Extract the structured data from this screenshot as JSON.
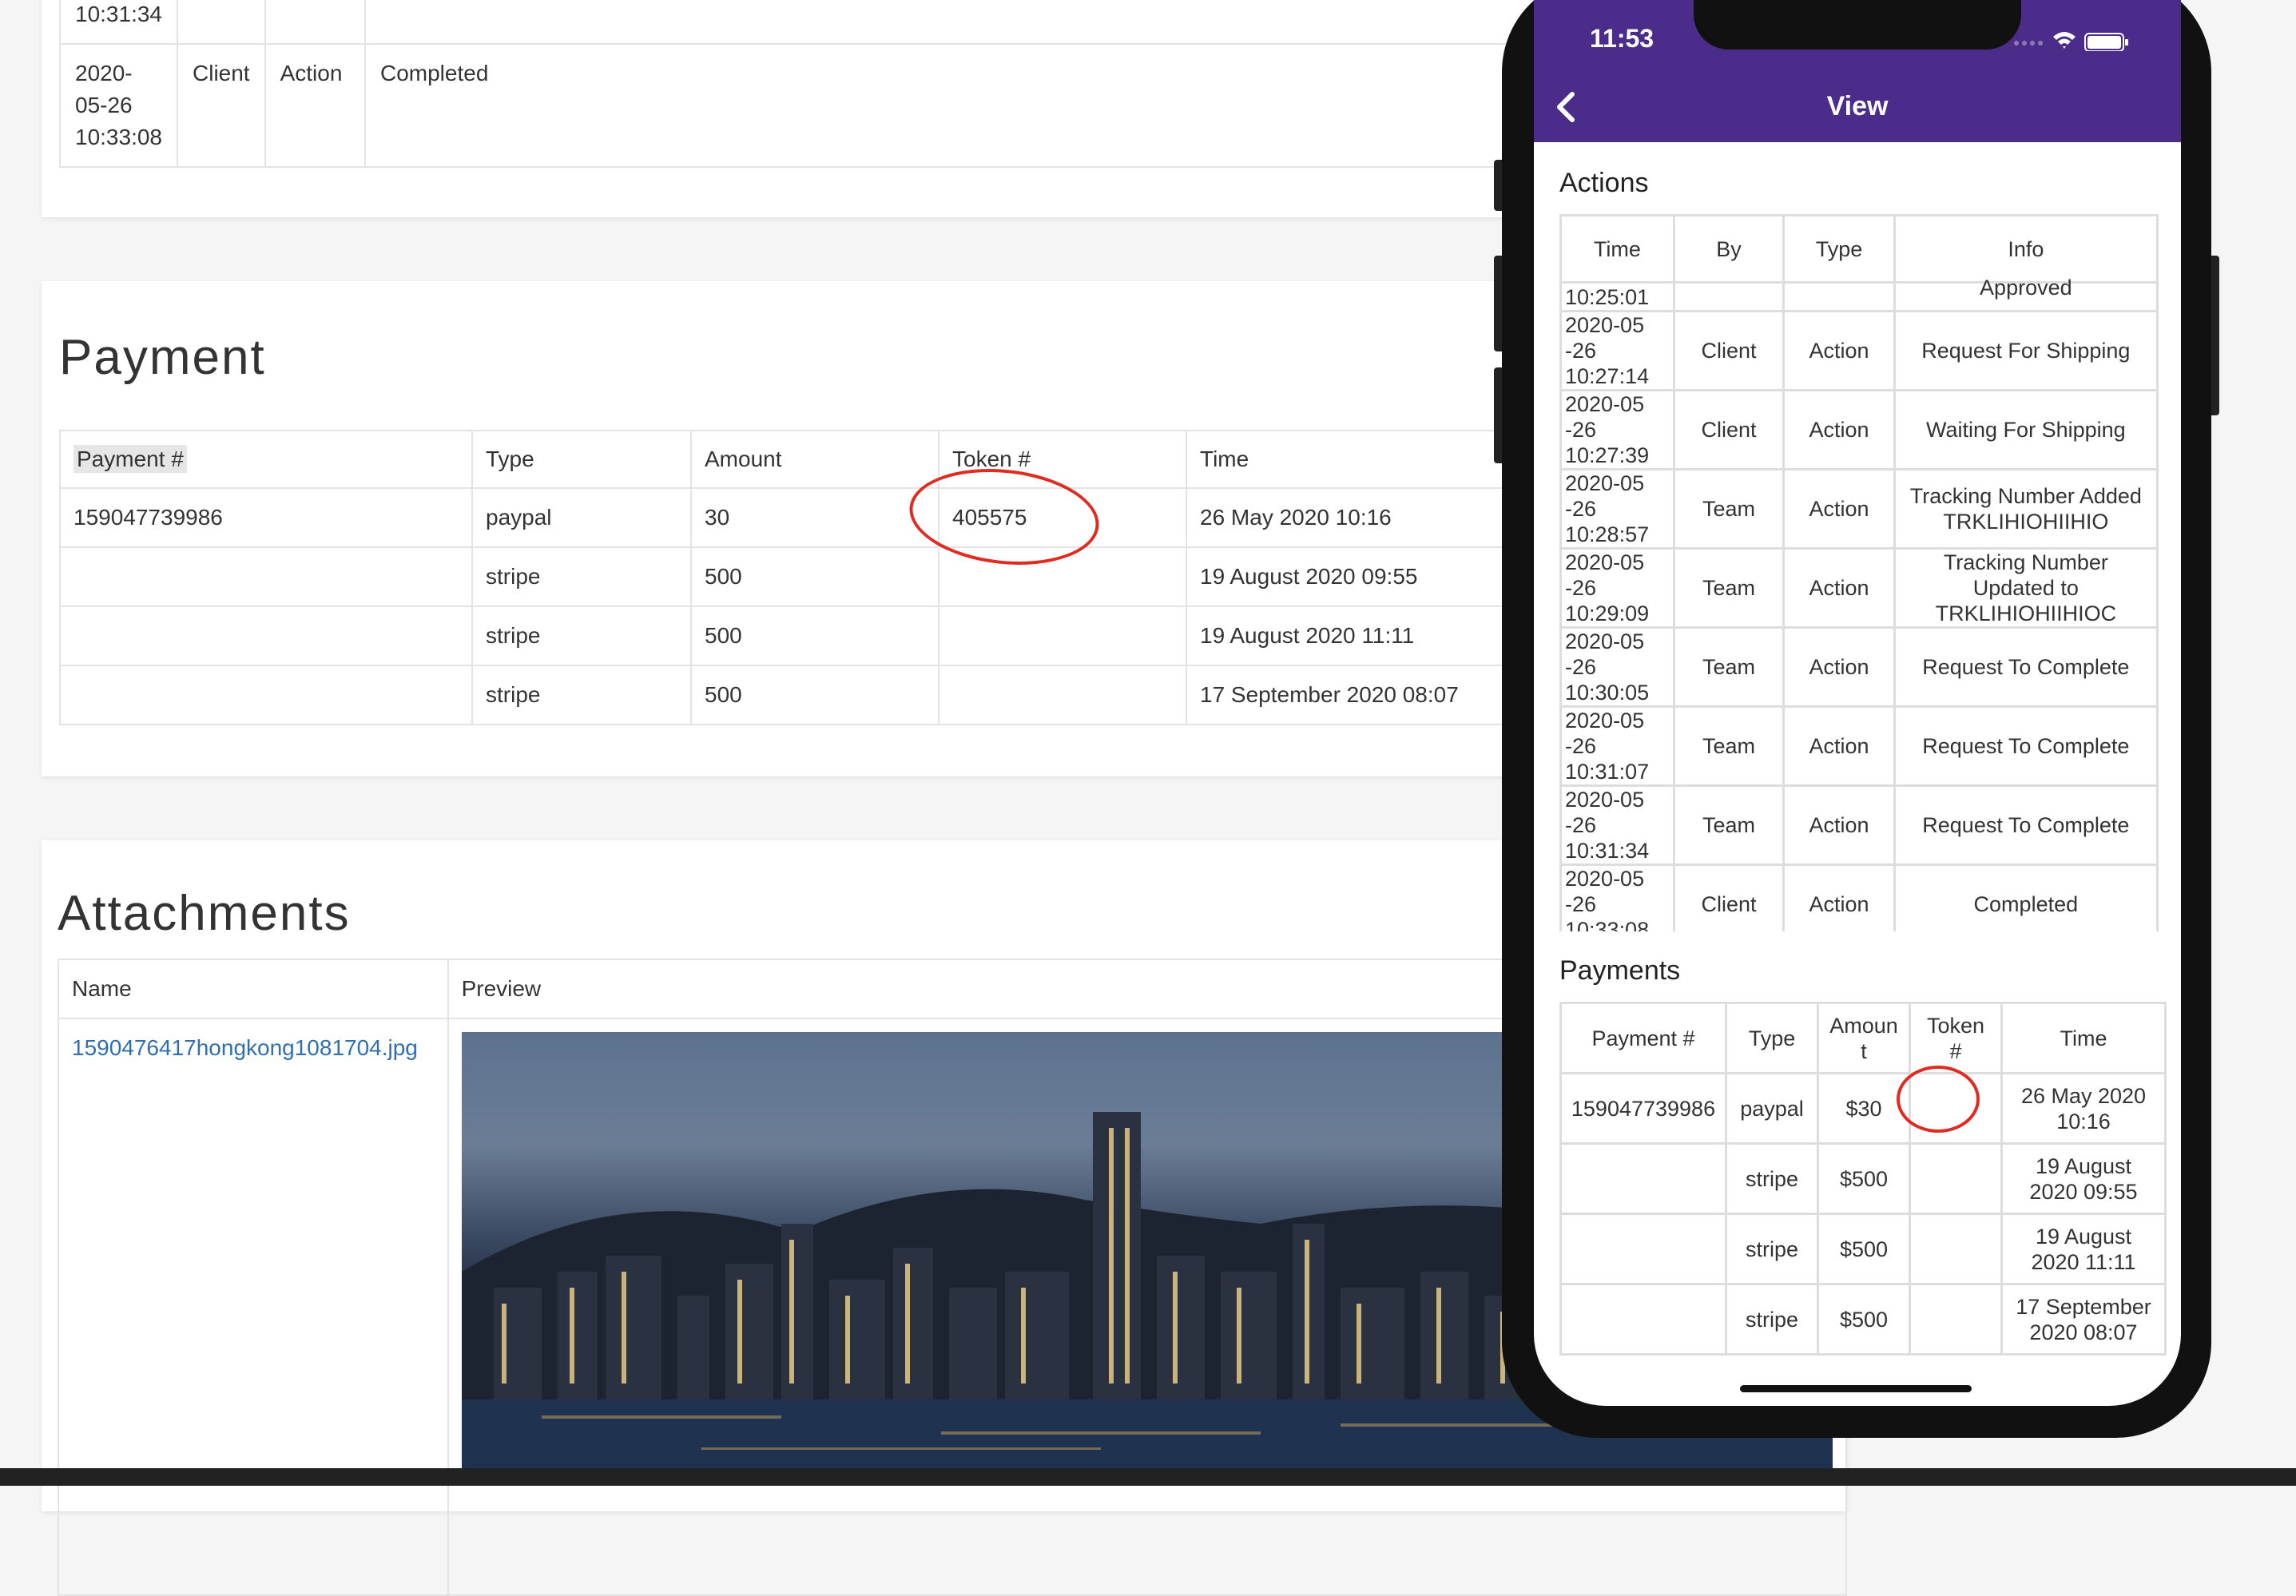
{
  "top_table": {
    "rows": [
      {
        "time": "10:31:34",
        "by": "",
        "type": "",
        "info": ""
      },
      {
        "time": "2020-\n05-26\n10:33:08",
        "by": "Client",
        "type": "Action",
        "info": "Completed"
      }
    ]
  },
  "payment": {
    "title": "Payment",
    "headers": [
      "Payment #",
      "Type",
      "Amount",
      "Token #",
      "Time"
    ],
    "rows": [
      [
        "159047739986",
        "paypal",
        "30",
        "405575",
        "26 May 2020 10:16"
      ],
      [
        "",
        "stripe",
        "500",
        "",
        "19 August 2020 09:55"
      ],
      [
        "",
        "stripe",
        "500",
        "",
        "19 August 2020 11:11"
      ],
      [
        "",
        "stripe",
        "500",
        "",
        "17 September 2020 08:07"
      ]
    ]
  },
  "attachments": {
    "title": "Attachments",
    "headers": [
      "Name",
      "Preview"
    ],
    "file": "1590476417hongkong1081704.jpg"
  },
  "phone": {
    "clock": "11:53",
    "nav_title": "View",
    "actions_title": "Actions",
    "actions_headers": [
      "Time",
      "By",
      "Type",
      "Info"
    ],
    "actions_rows": [
      [
        "10:25:01",
        "",
        "",
        "Approved"
      ],
      [
        "2020-05\n-26\n10:27:14",
        "Client",
        "Action",
        "Request For Shipping"
      ],
      [
        "2020-05\n-26\n10:27:39",
        "Client",
        "Action",
        "Waiting For Shipping"
      ],
      [
        "2020-05\n-26\n10:28:57",
        "Team",
        "Action",
        "Tracking Number Added\nTRKLIHIOHIIHIO"
      ],
      [
        "2020-05\n-26\n10:29:09",
        "Team",
        "Action",
        "Tracking Number\nUpdated to\nTRKLIHIOHIIHIOC"
      ],
      [
        "2020-05\n-26\n10:30:05",
        "Team",
        "Action",
        "Request To Complete"
      ],
      [
        "2020-05\n-26\n10:31:07",
        "Team",
        "Action",
        "Request To Complete"
      ],
      [
        "2020-05\n-26\n10:31:34",
        "Team",
        "Action",
        "Request To Complete"
      ],
      [
        "2020-05\n-26\n10:33:08",
        "Client",
        "Action",
        "Completed"
      ]
    ],
    "payments_title": "Payments",
    "payments_headers": [
      "Payment #",
      "Type",
      "Amoun\nt",
      "Token\n#",
      "Time"
    ],
    "payments_rows": [
      [
        "159047739986",
        "paypal",
        "$30",
        "",
        "26 May 2020\n10:16"
      ],
      [
        "",
        "stripe",
        "$500",
        "",
        "19 August\n2020 09:55"
      ],
      [
        "",
        "stripe",
        "$500",
        "",
        "19 August\n2020 11:11"
      ],
      [
        "",
        "stripe",
        "$500",
        "",
        "17 September\n2020 08:07"
      ]
    ]
  },
  "colors": {
    "nav": "#4b2c8a",
    "annotation": "#e02b20",
    "link": "#2f6fb0"
  }
}
